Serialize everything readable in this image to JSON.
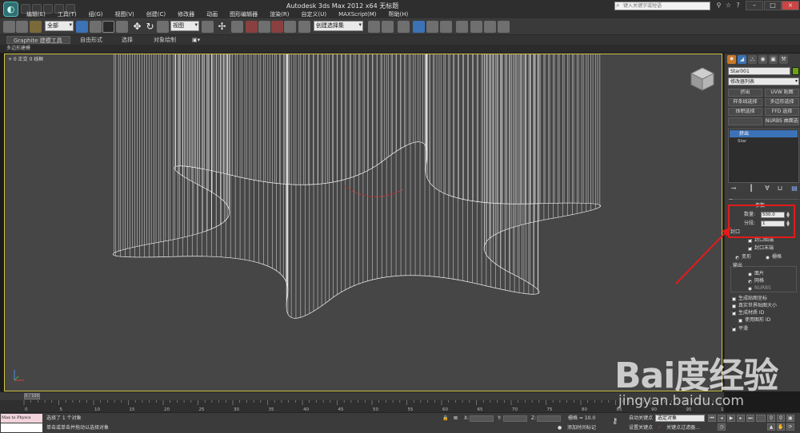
{
  "window": {
    "title": "Autodesk 3ds Max  2012 x64    无标题",
    "search_placeholder": "键入关键字或短语"
  },
  "menu": [
    "编辑(E)",
    "工具(T)",
    "组(G)",
    "视图(V)",
    "创建(C)",
    "修改器",
    "动画",
    "图形编辑器",
    "渲染(R)",
    "自定义(U)",
    "MAXScript(M)",
    "帮助(H)"
  ],
  "toolbar": {
    "filter": "全部",
    "refcoord": "视图",
    "selset": "创建选择集"
  },
  "ribbon": {
    "tabs": [
      "Graphite 建模工具",
      "自由形式",
      "选择",
      "对象绘制"
    ],
    "sub_label": "多边形建模"
  },
  "viewport": {
    "label": "+ 0 正交 0 线框"
  },
  "command_panel": {
    "object_name": "Star001",
    "modifier_list": "修改器列表",
    "modifier_buttons": [
      "挤出",
      "UVW 贴图",
      "样条线选择",
      "多边形选择",
      "体积选择",
      "FFD 选择",
      "",
      "NURBS 曲面选择"
    ],
    "stack": [
      "挤出",
      "Star"
    ],
    "params_title": "参数",
    "amount_label": "数量:",
    "amount_value": "500.0",
    "segments_label": "分段:",
    "segments_value": "1",
    "capping_title": "封口",
    "cap_start": "封口始端",
    "cap_end": "封口末端",
    "morph": "变形",
    "grid": "栅格",
    "output_title": "输出",
    "out_patch": "面片",
    "out_mesh": "网格",
    "out_nurbs": "NURBS",
    "gen_mapping": "生成贴图坐标",
    "real_world": "真实世界贴图大小",
    "gen_matid": "生成材质 ID",
    "use_shape_ids": "使用图形 ID",
    "smooth": "平滑"
  },
  "timeline": {
    "frame": "0 / 100",
    "ticks": [
      "0",
      "5",
      "10",
      "15",
      "20",
      "25",
      "30",
      "35",
      "40",
      "45",
      "50",
      "55",
      "60",
      "65",
      "70",
      "75",
      "80",
      "85",
      "90",
      "95",
      "100"
    ]
  },
  "status": {
    "maxscript": "Max to Physcs",
    "selected": "选择了 1 个对象",
    "prompt": "单击或单击并拖动以选择对象",
    "x_label": "X:",
    "y_label": "Y:",
    "z_label": "Z:",
    "grid": "栅格 = 10.0",
    "add_time_tag": "添加时间标记",
    "auto_key": "自动关键点",
    "set_key": "设置关键点",
    "key_mode": "选定对象",
    "key_filters": "关键点过滤器..."
  },
  "watermark": {
    "logo": "Bai度经验",
    "url": "jingyan.baidu.com"
  },
  "colors": {
    "viewport_bg": "#464646",
    "viewport_border": "#d1c445",
    "highlight": "#e31b1b",
    "object_color": "#6aa40d",
    "selection_blue": "#3c73b7"
  }
}
